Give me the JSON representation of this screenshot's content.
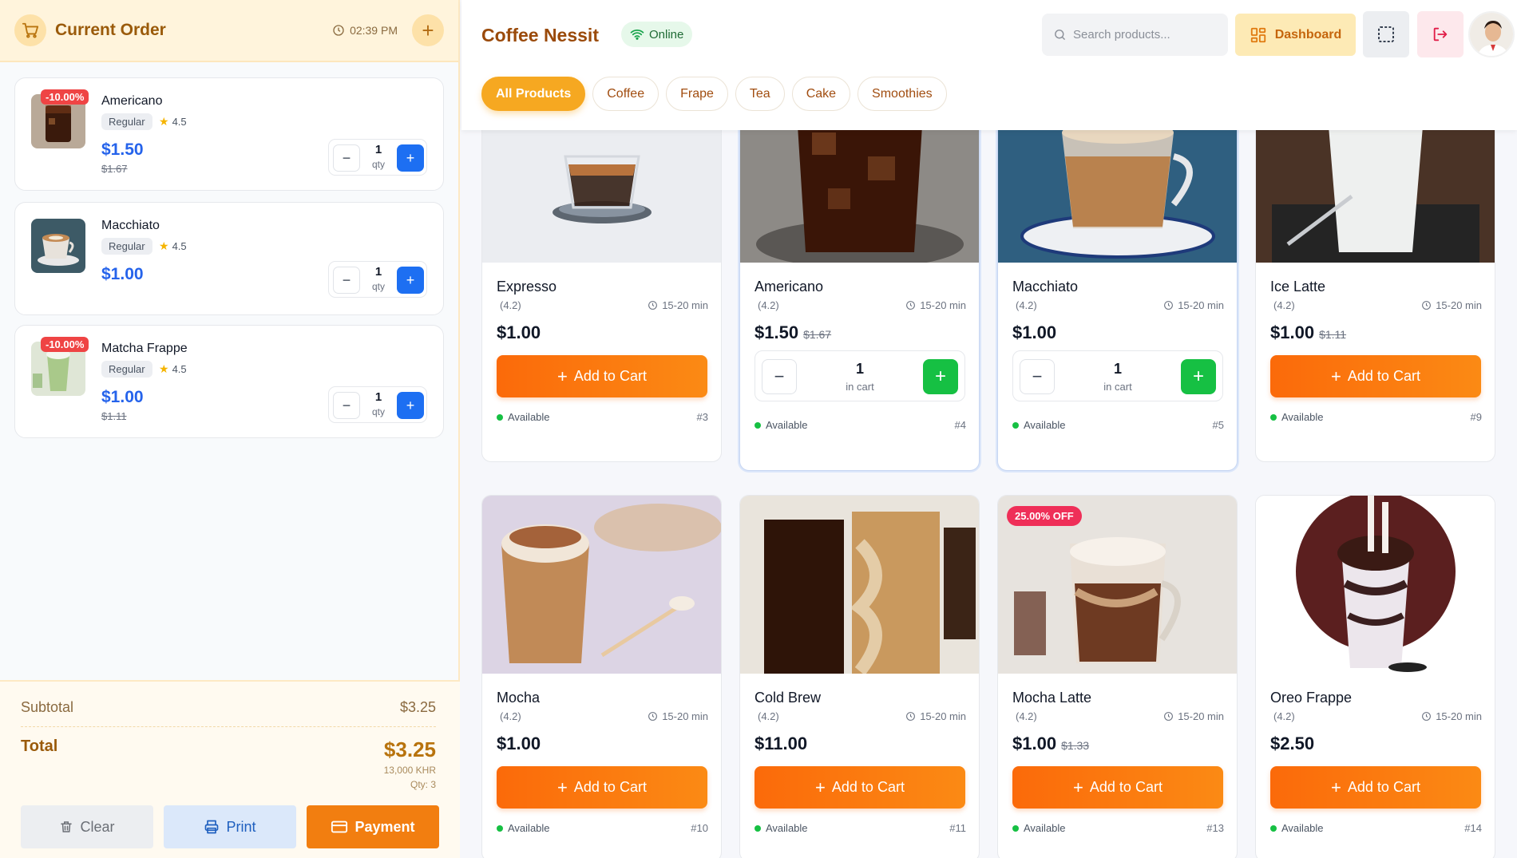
{
  "order": {
    "title": "Current Order",
    "time": "02:39 PM",
    "items": [
      {
        "name": "Americano",
        "size": "Regular",
        "rating": "4.5",
        "price": "$1.50",
        "old_price": "$1.67",
        "discount": "-10.00%",
        "qty": "1",
        "qty_label": "qty"
      },
      {
        "name": "Macchiato",
        "size": "Regular",
        "rating": "4.5",
        "price": "$1.00",
        "old_price": "",
        "discount": "",
        "qty": "1",
        "qty_label": "qty"
      },
      {
        "name": "Matcha Frappe",
        "size": "Regular",
        "rating": "4.5",
        "price": "$1.00",
        "old_price": "$1.11",
        "discount": "-10.00%",
        "qty": "1",
        "qty_label": "qty"
      }
    ],
    "subtotal_label": "Subtotal",
    "subtotal": "$3.25",
    "total_label": "Total",
    "total": "$3.25",
    "total_khr": "13,000 KHR",
    "total_qty": "Qty: 3",
    "buttons": {
      "clear": "Clear",
      "print": "Print",
      "payment": "Payment"
    }
  },
  "header": {
    "brand": "Coffee Nessit",
    "status": "Online",
    "search_placeholder": "Search products...",
    "dashboard": "Dashboard"
  },
  "tabs": [
    "All Products",
    "Coffee",
    "Frape",
    "Tea",
    "Cake",
    "Smoothies"
  ],
  "active_tab": "All Products",
  "products": [
    {
      "name": "Expresso",
      "rating": "(4.2)",
      "time": "15-20 min",
      "price": "$1.00",
      "old_price": "",
      "in_cart": "",
      "id": "#3",
      "status": "Available",
      "badge": ""
    },
    {
      "name": "Americano",
      "rating": "(4.2)",
      "time": "15-20 min",
      "price": "$1.50",
      "old_price": "$1.67",
      "in_cart": "1",
      "id": "#4",
      "status": "Available",
      "badge": ""
    },
    {
      "name": "Macchiato",
      "rating": "(4.2)",
      "time": "15-20 min",
      "price": "$1.00",
      "old_price": "",
      "in_cart": "1",
      "id": "#5",
      "status": "Available",
      "badge": ""
    },
    {
      "name": "Ice Latte",
      "rating": "(4.2)",
      "time": "15-20 min",
      "price": "$1.00",
      "old_price": "$1.11",
      "in_cart": "",
      "id": "#9",
      "status": "Available",
      "badge": ""
    },
    {
      "name": "Mocha",
      "rating": "(4.2)",
      "time": "15-20 min",
      "price": "$1.00",
      "old_price": "",
      "in_cart": "",
      "id": "#10",
      "status": "Available",
      "badge": ""
    },
    {
      "name": "Cold Brew",
      "rating": "(4.2)",
      "time": "15-20 min",
      "price": "$11.00",
      "old_price": "",
      "in_cart": "",
      "id": "#11",
      "status": "Available",
      "badge": ""
    },
    {
      "name": "Mocha Latte",
      "rating": "(4.2)",
      "time": "15-20 min",
      "price": "$1.00",
      "old_price": "$1.33",
      "in_cart": "",
      "id": "#13",
      "status": "Available",
      "badge": "25.00% OFF"
    },
    {
      "name": "Oreo Frappe",
      "rating": "(4.2)",
      "time": "15-20 min",
      "price": "$2.50",
      "old_price": "",
      "in_cart": "",
      "id": "#14",
      "status": "Available",
      "badge": ""
    }
  ],
  "labels": {
    "add_to_cart": "Add to Cart",
    "in_cart": "in cart"
  },
  "colors": {
    "brand": "#9a4a0a",
    "accent": "#fb6a0a",
    "qty_blue": "#1d6ff2",
    "stepper_green": "#16c043",
    "discount_red": "#ef4444"
  }
}
